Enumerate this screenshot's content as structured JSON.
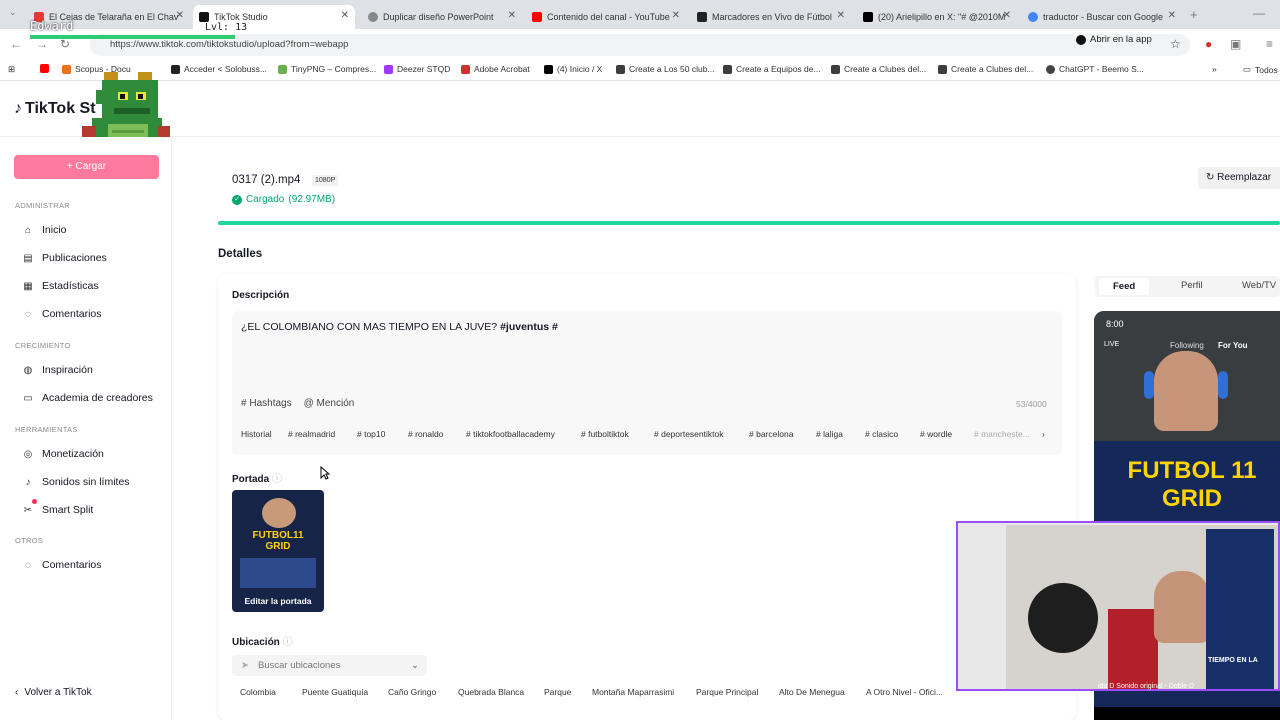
{
  "browser": {
    "tabs": [
      {
        "title": "El Cejas de Telaraña en El Chav",
        "color": "#e53935"
      },
      {
        "title": "TikTok Studio",
        "color": "#111111"
      },
      {
        "title": "Duplicar diseño PowerPoint",
        "color": "#888888"
      },
      {
        "title": "Contenido del canal - YouTube",
        "color": "#ff0000"
      },
      {
        "title": "Marcadores en Vivo de Fútbol",
        "color": "#222222"
      },
      {
        "title": "(20) Arielipillo en X: \"# @2010M",
        "color": "#000000"
      },
      {
        "title": "traductor - Buscar con Google",
        "color": "#4285f4"
      }
    ],
    "url": "https://www.tiktok.com/tiktokstudio/upload?from=webapp",
    "open_in_app": "Abrir en la app",
    "bookmarks": [
      {
        "label": "Scopus - Docu",
        "color": "#e8711a"
      },
      {
        "label": "Acceder < Solobuss...",
        "color": "#222222"
      },
      {
        "label": "TinyPNG – Compres...",
        "color": "#6ab04c"
      },
      {
        "label": "Deezer STQD",
        "color": "#a238ff"
      },
      {
        "label": "Adobe Acrobat",
        "color": "#d32f2f"
      },
      {
        "label": "(4) Inicio / X",
        "color": "#000000"
      },
      {
        "label": "Create a Los 50 club...",
        "color": "#3d3d3d"
      },
      {
        "label": "Create a Equipos de...",
        "color": "#3d3d3d"
      },
      {
        "label": "Create a Clubes del...",
        "color": "#3d3d3d"
      },
      {
        "label": "Create a Clubes del...",
        "color": "#3d3d3d"
      },
      {
        "label": "ChatGPT - Beemo S...",
        "color": "#444444"
      }
    ],
    "all_bookmarks": "Todos"
  },
  "overlay": {
    "name": "Edward",
    "level": "Lvl: 13"
  },
  "app": {
    "logo": "TikTok St"
  },
  "sidebar": {
    "upload": "+ Cargar",
    "sections": {
      "admin": "ADMINISTRAR",
      "growth": "CRECIMIENTO",
      "tools": "HERRAMIENTAS",
      "others": "OTROS"
    },
    "items": [
      {
        "label": "Inicio",
        "icon": "home-icon",
        "glyph": "⌂"
      },
      {
        "label": "Publicaciones",
        "icon": "list-icon",
        "glyph": "▤"
      },
      {
        "label": "Estadísticas",
        "icon": "chart-icon",
        "glyph": "▦"
      },
      {
        "label": "Comentarios",
        "icon": "comment-icon",
        "glyph": "◌"
      },
      {
        "label": "Inspiración",
        "icon": "bulb-icon",
        "glyph": "◍"
      },
      {
        "label": "Academia de creadores",
        "icon": "academy-icon",
        "glyph": "▭"
      },
      {
        "label": "Monetización",
        "icon": "money-icon",
        "glyph": "◎"
      },
      {
        "label": "Sonidos sin límites",
        "icon": "music-icon",
        "glyph": "♪"
      },
      {
        "label": "Smart Split",
        "icon": "split-icon",
        "glyph": "✂"
      },
      {
        "label": "Comentarios",
        "icon": "comment-icon",
        "glyph": "◌"
      }
    ],
    "back": "Volver a TikTok"
  },
  "upload": {
    "file_name": "0317 (2).mp4",
    "quality": "1080P",
    "status": "Cargado",
    "size": "(92.97MB)",
    "replace": "Reemplazar",
    "progress_fraction": 1.0,
    "accent": "#20d5a0"
  },
  "details": {
    "heading": "Detalles",
    "description_label": "Descripción",
    "description_text": "¿EL COLOMBIANO CON MAS TIEMPO EN LA JUVE? ",
    "description_tags": "#juventus #",
    "hashtags_btn": "Hashtags",
    "mention_btn": "Mención",
    "char_count": "53/4000",
    "history": "Historial",
    "suggested_tags": [
      "# realmadrid",
      "# top10",
      "# ronaldo",
      "# tiktokfootballacademy",
      "# futboltiktok",
      "# deportesentiktok",
      "# barcelona",
      "# laliga",
      "# clasico",
      "# wordle",
      "# mancheste..."
    ],
    "cover_label": "Portada",
    "cover_title_1": "FUTBOL11",
    "cover_title_2": "GRID",
    "cover_edit": "Editar la portada",
    "location_label": "Ubicación",
    "location_placeholder": "Buscar ubicaciones",
    "locations": [
      "Colombia",
      "Puente Guatiquía",
      "Caño Gringo",
      "Quebrada Blanca",
      "Parque",
      "Montaña Maparrasimi",
      "Parque Principal",
      "Alto De Menegua",
      "A Otro Nivel - Ofici..."
    ]
  },
  "preview": {
    "tabs": [
      "Feed",
      "Perfil",
      "Web/TV"
    ],
    "time": "8:00",
    "following": "Following",
    "for_you": "For You",
    "title_1": "FUTBOL 11",
    "title_2": "GRID",
    "live": "LIVE",
    "stream_text": "TIEMPO EN LA",
    "music": "ido D   Sonido original - Doble D"
  }
}
